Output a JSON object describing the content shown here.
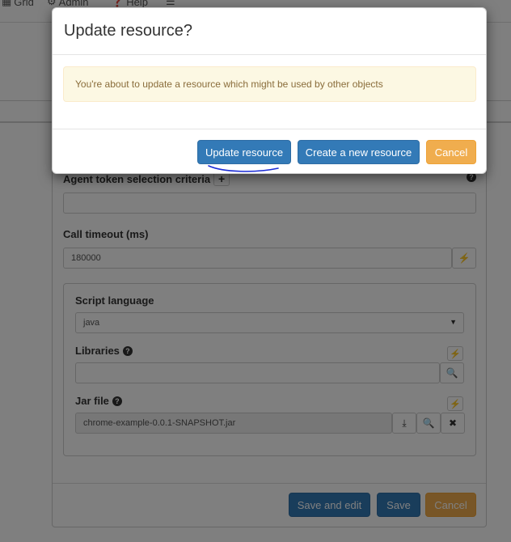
{
  "nav": {
    "items": [
      {
        "icon": "grid-icon",
        "label": "Grid"
      },
      {
        "icon": "gear-icon",
        "label": "Admin"
      },
      {
        "icon": "help-icon",
        "label": "Help"
      }
    ]
  },
  "form": {
    "agent_token_label": "Agent token selection criteria",
    "agent_token_value": "",
    "call_timeout_label": "Call timeout (ms)",
    "call_timeout_value": "180000",
    "script_language_label": "Script language",
    "script_language_value": "java",
    "libraries_label": "Libraries",
    "libraries_value": "",
    "jar_file_label": "Jar file",
    "jar_file_value": "chrome-example-0.0.1-SNAPSHOT.jar"
  },
  "footer": {
    "save_and_edit": "Save and edit",
    "save": "Save",
    "cancel": "Cancel"
  },
  "modal": {
    "title": "Update resource?",
    "message": "You're about to update a resource which might be used by other objects",
    "update_button": "Update resource",
    "create_button": "Create a new resource",
    "cancel_button": "Cancel"
  },
  "colors": {
    "primary": "#337ab7",
    "warning": "#f0ad4e",
    "alert_bg": "#fcf8e3",
    "alert_text": "#8a6d3b",
    "annotation": "#1a2bd6"
  }
}
